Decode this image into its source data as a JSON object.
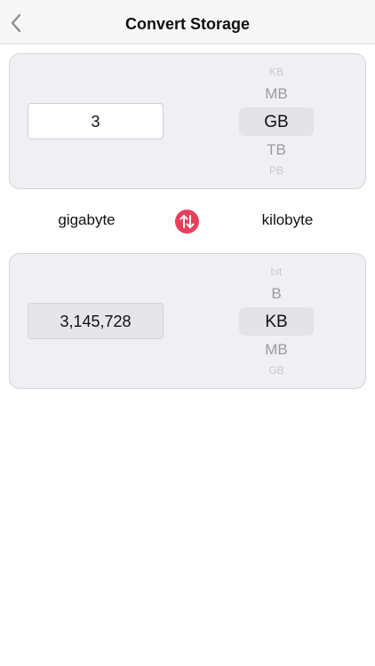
{
  "header": {
    "title": "Convert Storage",
    "back_icon": "chevron-left-icon"
  },
  "from": {
    "value": "3",
    "unit_name": "gigabyte",
    "picker": {
      "above_far": "KB",
      "above_near": "MB",
      "selected": "GB",
      "below_near": "TB",
      "below_far": "PB"
    }
  },
  "swap": {
    "icon": "swap-arrows-icon",
    "color": "#e8405a"
  },
  "to": {
    "value": "3,145,728",
    "unit_name": "kilobyte",
    "picker": {
      "above_far": "bit",
      "above_near": "B",
      "selected": "KB",
      "below_near": "MB",
      "below_far": "GB"
    }
  }
}
